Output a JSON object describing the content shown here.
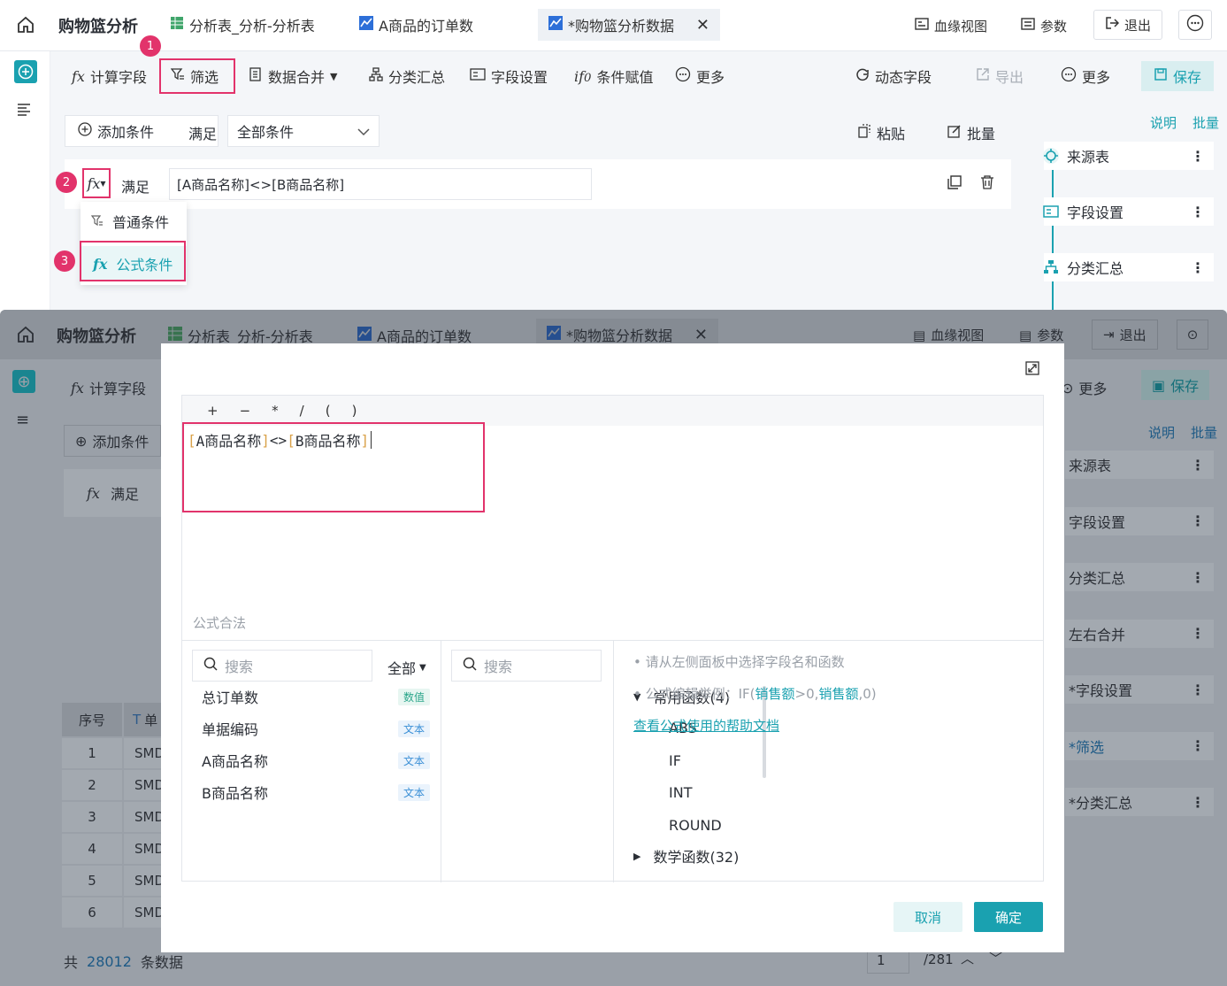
{
  "top": {
    "app_title": "购物篮分析",
    "tabs": [
      {
        "label": "分析表_分析-分析表",
        "icon": "table-icon"
      },
      {
        "label": "A商品的订单数",
        "icon": "chart-icon"
      },
      {
        "label": "*购物篮分析数据",
        "icon": "chart-icon",
        "active": true
      }
    ],
    "right": {
      "lineage": "血缘视图",
      "params": "参数",
      "exit": "退出"
    }
  },
  "toolbar": {
    "calc_field": "计算字段",
    "filter": "筛选",
    "merge": "数据合并",
    "group": "分类汇总",
    "field_settings": "字段设置",
    "cond_assign": "条件赋值",
    "more": "更多",
    "dynamic_field": "动态字段",
    "export": "导出",
    "more2": "更多",
    "save": "保存"
  },
  "filter": {
    "add_condition": "添加条件",
    "satisfy": "满足",
    "satisfy_option": "全部条件",
    "paste": "粘贴",
    "batch": "批量",
    "row_satisfy": "满足",
    "row_formula": "[A商品名称]<>[B商品名称]",
    "menu_normal": "普通条件",
    "menu_formula": "公式条件"
  },
  "badges": [
    "1",
    "2",
    "3"
  ],
  "steps": {
    "explain": "说明",
    "batch": "批量",
    "nodes": [
      "来源表",
      "字段设置",
      "分类汇总"
    ],
    "nodes_bottom": [
      "来源表",
      "字段设置",
      "分类汇总",
      "左右合并",
      "*字段设置",
      "*筛选",
      "*分类汇总"
    ]
  },
  "back": {
    "add_condition": "添加条件",
    "satisfy": "满足",
    "more": "更多",
    "save": "保存",
    "calc_field": "计算字段",
    "table_headers": [
      "序号",
      "单"
    ],
    "rows": [
      [
        "1",
        "SMD"
      ],
      [
        "2",
        "SMD"
      ],
      [
        "3",
        "SMD"
      ],
      [
        "4",
        "SMD"
      ],
      [
        "5",
        "SMD"
      ],
      [
        "6",
        "SMD"
      ]
    ],
    "total_prefix": "共",
    "total": "28012",
    "total_suffix": "条数据",
    "page": "1",
    "pages": "/281"
  },
  "modal": {
    "operators": [
      "+",
      "−",
      "*",
      "/",
      "(",
      ")"
    ],
    "formula_field_a": "A商品名称",
    "formula_op": "<>",
    "formula_field_b": "B商品名称",
    "status": "公式合法",
    "field_search": "搜索",
    "field_filter": "全部",
    "fields": [
      {
        "name": "总订单数",
        "type": "数值"
      },
      {
        "name": "单据编码",
        "type": "文本"
      },
      {
        "name": "A商品名称",
        "type": "文本"
      },
      {
        "name": "B商品名称",
        "type": "文本"
      }
    ],
    "fn_search": "搜索",
    "fn_group": "常用函数(4)",
    "functions": [
      "ABS",
      "IF",
      "INT",
      "ROUND"
    ],
    "fn_group2": "数学函数(32)",
    "hint1": "• 请从左侧面板中选择字段名和函数",
    "hint2_prefix": "• 公式编辑举例：IF(",
    "hint2_field1": "销售额",
    "hint2_mid": ">0,",
    "hint2_field2": "销售额",
    "hint2_suffix": ",0)",
    "help_link": "查看公式使用的帮助文档",
    "cancel": "取消",
    "ok": "确定"
  },
  "colors": {
    "accent": "#1aa1b0",
    "mark": "#e2336b"
  }
}
